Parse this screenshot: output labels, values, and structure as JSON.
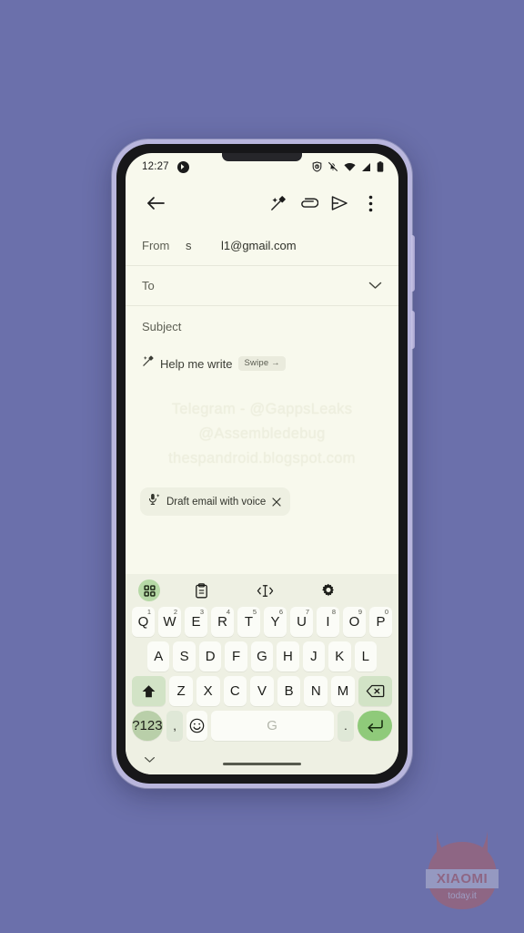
{
  "wallpaper": {
    "color": "#6b70ab"
  },
  "phone": {
    "frame_color": "#b9b6dd",
    "screen_bg": "#f8f9ed"
  },
  "status_bar": {
    "time": "12:27",
    "badge_icon": "notification-dot-icon",
    "icons": [
      "alarm-shield-icon",
      "mute-bell-icon",
      "wifi-icon",
      "signal-icon",
      "battery-icon"
    ]
  },
  "app_bar": {
    "back_icon": "back-arrow-icon",
    "actions": [
      {
        "name": "magic-compose-icon",
        "label": "Help me write"
      },
      {
        "name": "attach-icon",
        "label": "Attach file"
      },
      {
        "name": "send-icon",
        "label": "Send"
      },
      {
        "name": "overflow-menu-icon",
        "label": "More options"
      }
    ]
  },
  "compose": {
    "from": {
      "label": "From",
      "account": "s",
      "email": "l1@gmail.com"
    },
    "to": {
      "label": "To",
      "value": "",
      "expand_icon": "chevron-down-icon"
    },
    "subject": {
      "label": "Subject",
      "value": ""
    },
    "help_me_write": {
      "icon": "magic-pen-icon",
      "label": "Help me write",
      "chip": "Swipe →"
    },
    "body_watermark": [
      "Telegram - @GappsLeaks",
      "@Assembledebug",
      "thespandroid.blogspot.com"
    ],
    "voice_chip": {
      "icon": "mic-sparkle-icon",
      "label": "Draft email with voice",
      "close_icon": "close-icon"
    }
  },
  "keyboard": {
    "toolbar": [
      {
        "name": "apps-grid-icon",
        "active": true
      },
      {
        "name": "clipboard-icon",
        "active": false
      },
      {
        "name": "text-cursor-move-icon",
        "active": false
      },
      {
        "name": "settings-gear-icon",
        "active": false
      }
    ],
    "row1": [
      {
        "key": "Q",
        "sup": "1"
      },
      {
        "key": "W",
        "sup": "2"
      },
      {
        "key": "E",
        "sup": "3"
      },
      {
        "key": "R",
        "sup": "4"
      },
      {
        "key": "T",
        "sup": "5"
      },
      {
        "key": "Y",
        "sup": "6"
      },
      {
        "key": "U",
        "sup": "7"
      },
      {
        "key": "I",
        "sup": "8"
      },
      {
        "key": "O",
        "sup": "9"
      },
      {
        "key": "P",
        "sup": "0"
      }
    ],
    "row2": [
      "A",
      "S",
      "D",
      "F",
      "G",
      "H",
      "J",
      "K",
      "L"
    ],
    "row3": {
      "shift": "shift-icon",
      "letters": [
        "Z",
        "X",
        "C",
        "V",
        "B",
        "N",
        "M"
      ],
      "backspace": "backspace-icon"
    },
    "row4": {
      "symbols": "?123",
      "comma": ",",
      "emoji": "emoji-icon",
      "space": "G",
      "period": ".",
      "enter": "enter-icon"
    },
    "hide_icon": "chevron-down-icon",
    "colors": {
      "background": "#eef0e3",
      "key": "#fbfcf7",
      "function_key": "#d2e3c6",
      "enter_key": "#8fca7a",
      "symbols_key": "#b9cfa9"
    }
  },
  "watermark": {
    "brand": "XIAOMI",
    "site": "today.it"
  }
}
